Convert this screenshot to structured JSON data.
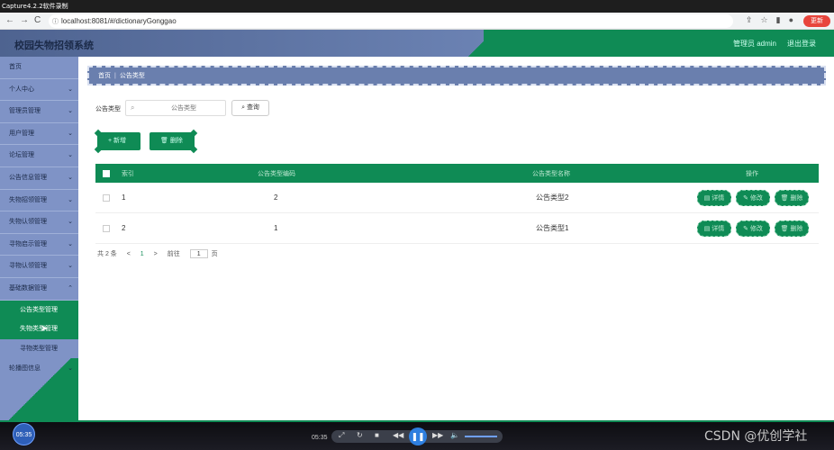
{
  "capture_title": "Capture4.2.2软件录制",
  "browser": {
    "url": "localhost:8081/#/dictionaryGonggao",
    "update_label": "更新",
    "nav_back": "←",
    "nav_forward": "→",
    "nav_reload": "C"
  },
  "header": {
    "app_title": "校园失物招领系统",
    "user_label": "管理员 admin",
    "logout_label": "退出登录"
  },
  "sidebar": {
    "items": [
      {
        "label": "首页",
        "has_chevron": false
      },
      {
        "label": "个人中心",
        "has_chevron": true
      },
      {
        "label": "管理员管理",
        "has_chevron": true
      },
      {
        "label": "用户管理",
        "has_chevron": true
      },
      {
        "label": "论坛管理",
        "has_chevron": true
      },
      {
        "label": "公告信息管理",
        "has_chevron": true
      },
      {
        "label": "失物招领管理",
        "has_chevron": true
      },
      {
        "label": "失物认领管理",
        "has_chevron": true
      },
      {
        "label": "寻物启示管理",
        "has_chevron": true
      },
      {
        "label": "寻物认领管理",
        "has_chevron": true
      },
      {
        "label": "基础数据管理",
        "has_chevron": true
      }
    ],
    "submenu": [
      {
        "label": "公告类型管理"
      },
      {
        "label": "失物类型管理"
      },
      {
        "label": "寻物类型管理"
      }
    ],
    "after": [
      {
        "label": "轮播图信息",
        "has_chevron": true
      }
    ]
  },
  "breadcrumb": {
    "home": "首页",
    "current": "公告类型"
  },
  "search": {
    "label": "公告类型",
    "placeholder": "公告类型",
    "query_label": "查询"
  },
  "actions": {
    "add_label": "新增",
    "delete_label": "删除"
  },
  "table": {
    "columns": [
      "索引",
      "公告类型编码",
      "公告类型名称",
      "操作"
    ],
    "rows": [
      {
        "index": "1",
        "code": "2",
        "name": "公告类型2"
      },
      {
        "index": "2",
        "code": "1",
        "name": "公告类型1"
      }
    ],
    "row_actions": {
      "detail": "详情",
      "edit": "修改",
      "delete": "删除"
    }
  },
  "pager": {
    "total": "共 2 条",
    "prev": "<",
    "page": "1",
    "next": ">",
    "goto_label": "前往",
    "goto_value": "1",
    "page_suffix": "页"
  },
  "player": {
    "bubble_time": "05:35",
    "time": "05:35"
  },
  "watermark": "CSDN @优创学社",
  "colors": {
    "accent_green": "#0f8b55",
    "sidebar_blue": "#7f93c6",
    "header_blue": "#4e6390"
  }
}
